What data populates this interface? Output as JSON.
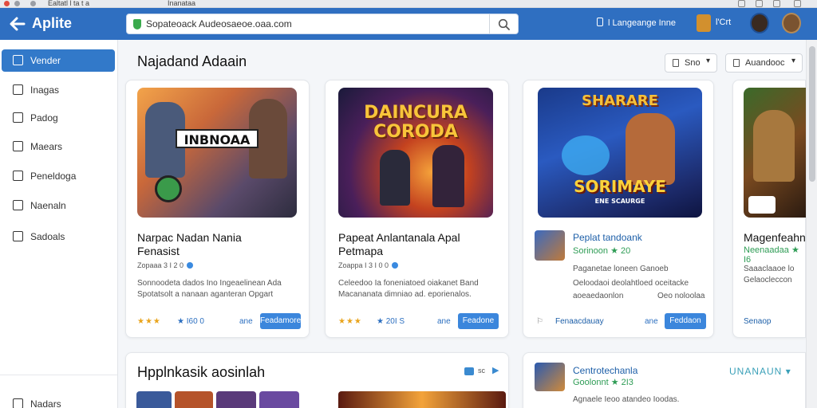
{
  "chrome": {
    "title_left": "Ealtatl l ta t a",
    "title_mid": "Inanataa"
  },
  "header": {
    "brand": "Aplite",
    "search_value": "Sopateoack Audeosaeoe.oaa.com",
    "language": "l Langeange Inne",
    "user_short": "l'Crt"
  },
  "sidebar": {
    "items": [
      {
        "label": "Vender",
        "icon": "home-icon",
        "active": true
      },
      {
        "label": "Inagas",
        "icon": "house-icon",
        "active": false
      },
      {
        "label": "Padog",
        "icon": "calendar-icon",
        "active": false
      },
      {
        "label": "Maears",
        "icon": "list-icon",
        "active": false
      },
      {
        "label": "Peneldoga",
        "icon": "lock-icon",
        "active": false
      },
      {
        "label": "Naenaln",
        "icon": "chart-icon",
        "active": false
      },
      {
        "label": "Sadoals",
        "icon": "document-icon",
        "active": false
      }
    ],
    "bottom_item": "Nadars"
  },
  "main": {
    "section_title": "Najadand Adaain",
    "filter_1": "Sno",
    "filter_2": "Auandooc",
    "cards": [
      {
        "banner": "INBNOAA",
        "title": "Narpac Nadan Nania",
        "subtitle": "Fenasist",
        "meta": "Zopaaa 3 I 2 0",
        "desc_1": "Sonnoodeta dados Ino Ingeaelinean Ada",
        "desc_2": "Spotatsolt a nanaan aganteran Opgart",
        "stars": "★★★",
        "rating": "★ I60 0",
        "small": "ane",
        "button": "Feadamore"
      },
      {
        "banner": "DAINCURA CORODA",
        "title": "Papeat Anlantanala Apal",
        "subtitle": "Petmapa",
        "meta": "Zoappa I 3 I 0 0",
        "desc_1": "Celeedoo Ia foneniatoed oiakanet Band",
        "desc_2": "Macananata dimniao ad. eporienalos.",
        "stars": "★★★",
        "rating": "★ 20I S",
        "small": "ane",
        "button": "Feadone"
      },
      {
        "banner_top": "SHARARE",
        "banner": "SORIMAYE",
        "banner_sub": "ENE SCAURGE",
        "title": "Peplat tandoank",
        "sub": "Sorinoon ★ 20",
        "desc_1": "Paganetae loneen Ganoeb",
        "desc_2": "Oeloodaoi deolahtloed oceitacke",
        "desc_3": "aoeaedaonlon",
        "desc_3b": "Oeo noloolaa",
        "small": "Fenaacdauay",
        "small2": "ane",
        "button": "Feddaon"
      },
      {
        "title": "Magenfeahn",
        "sub": "Neenaadaa ★ I6",
        "desc_1": "Saaaclaaoe lo",
        "desc_2": "Gelaocleccon",
        "small": "Senaop"
      }
    ],
    "section2_title": "Hpplnkasik aosinlah",
    "section2_right": "sc",
    "list_item": {
      "title": "Centrotechanla",
      "sub": "Goolonnt ★ 2I3",
      "desc": "Agnaele Ieoo atandeo Ioodas.",
      "action": "UNANAUN"
    }
  }
}
